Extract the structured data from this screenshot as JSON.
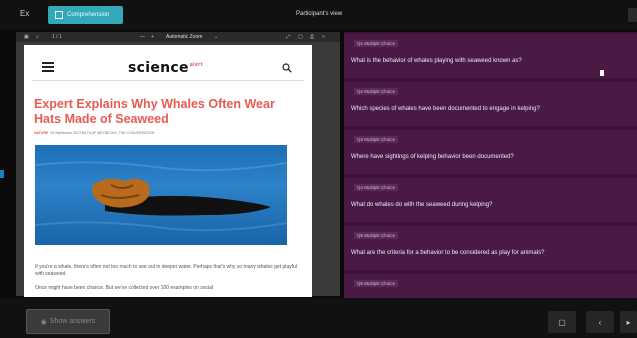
{
  "topbar": {
    "back_label": "Ex",
    "tab_label": "Comprehension",
    "participant_view": "Participant's view"
  },
  "pdf_toolbar": {
    "page_label": "1 / 1",
    "zoom_label": "Automatic Zoom"
  },
  "article": {
    "site_name": "science",
    "logo_sup": "alert",
    "headline": "Expert Explains Why Whales Often Wear Hats Made of Seaweed",
    "byline_tag": "NATURE",
    "byline_rest": "28 September 2023  By OLAF MEYNECKE, THE CONVERSATION",
    "caption": "",
    "paragraph1": "If you're a whale, there's often not too much to see out in deeper water. Perhaps that's why so many whales get playful with seaweed.",
    "paragraph2": "Once might have been chance. But we've collected over 100 examples on social"
  },
  "questions": [
    {
      "badge": "Q1 Multiple Choice",
      "text": "What is the behavior of whales playing with seaweed known as?"
    },
    {
      "badge": "Q2 Multiple Choice",
      "text": "Which species of whales have been documented to engage in kelping?"
    },
    {
      "badge": "Q3 Multiple Choice",
      "text": "Where have sightings of kelping behavior been documented?"
    },
    {
      "badge": "Q4 Multiple Choice",
      "text": "What do whales do with the seaweed during kelping?"
    },
    {
      "badge": "Q5 Multiple Choice",
      "text": "What are the criteria for a behavior to be considered as play for animals?"
    },
    {
      "badge": "Q6 Multiple Choice",
      "text": ""
    }
  ],
  "bottom": {
    "show_answers": "Show answers"
  },
  "colors": {
    "accent": "#31a9b8",
    "right_panel": "#3c1536",
    "card": "#4a1a44",
    "headline": "#e75a54"
  }
}
